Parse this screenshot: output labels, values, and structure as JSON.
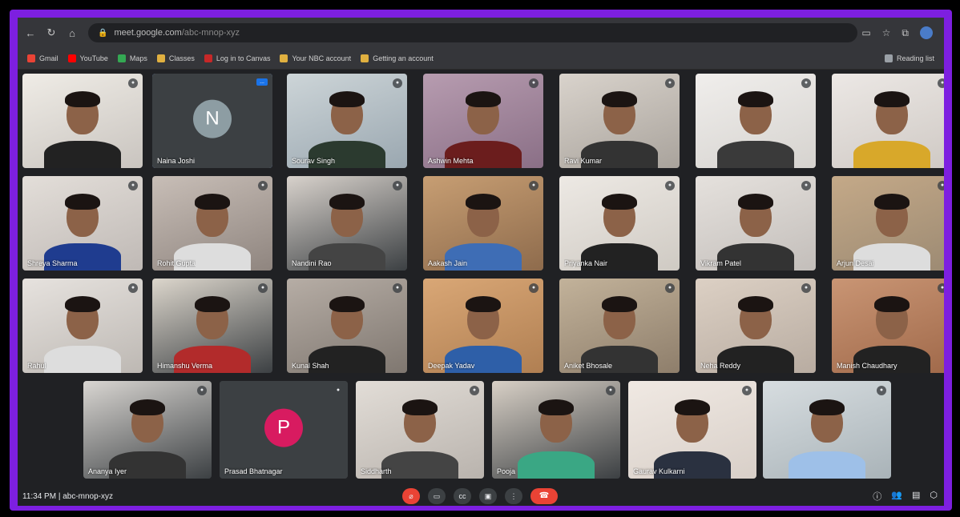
{
  "browser": {
    "url_host": "meet.google.com",
    "url_path": "/abc-mnop-xyz",
    "bookmarks": [
      "Gmail",
      "YouTube",
      "Maps",
      "Classes",
      "Log in to Canvas",
      "Your NBC account",
      "Getting an account"
    ],
    "bookmarks_right": "Reading list"
  },
  "participants": [
    {
      "name": ""
    },
    {
      "name": "Naina Joshi",
      "initial": "N",
      "avatar_color": "#8d9da3",
      "active": true,
      "pin_label": "..."
    },
    {
      "name": "Sourav Singh"
    },
    {
      "name": "Ashwin Mehta"
    },
    {
      "name": "Ravi Kumar"
    },
    {
      "name": ""
    },
    {
      "name": ""
    },
    {
      "name": "Shreya Sharma"
    },
    {
      "name": "Rohit Gupta"
    },
    {
      "name": "Nandini Rao"
    },
    {
      "name": "Aakash Jain"
    },
    {
      "name": "Priyanka Nair"
    },
    {
      "name": "Vikram Patel"
    },
    {
      "name": "Arjun Desai"
    },
    {
      "name": "Rahul"
    },
    {
      "name": "Himanshu Verma"
    },
    {
      "name": "Kunal Shah"
    },
    {
      "name": "Deepak Yadav"
    },
    {
      "name": "Aniket Bhosale"
    },
    {
      "name": "Neha Reddy"
    },
    {
      "name": "Manish Chaudhary"
    },
    {
      "name": "Ananya Iyer"
    },
    {
      "name": "Prasad Bhatnagar",
      "initial": "P",
      "avatar_color": "#d81b60"
    },
    {
      "name": "Siddharth"
    },
    {
      "name": "Pooja"
    },
    {
      "name": "Gaurav Kulkarni"
    },
    {
      "name": ""
    }
  ],
  "bottom": {
    "time": "11:34 PM | abc-mnop-xyz"
  },
  "icons": {
    "mic": "mic-icon",
    "camera": "camera-icon",
    "captions": "captions-icon",
    "present": "present-icon",
    "more": "more-icon",
    "end": "end-call-icon"
  }
}
